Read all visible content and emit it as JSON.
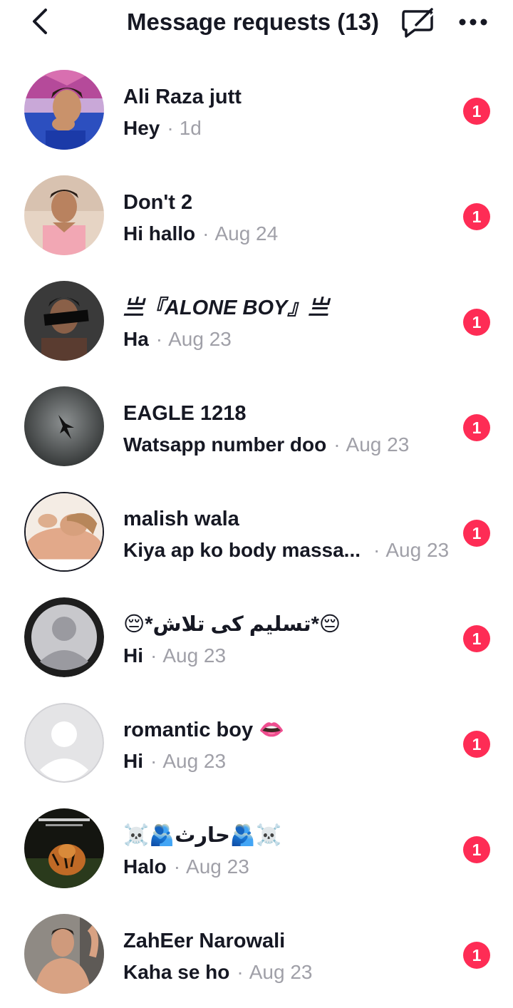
{
  "header": {
    "title": "Message requests (13)",
    "back_icon": "chevron-left-icon",
    "comment_icon": "comment-off-icon",
    "more_icon": "more-horizontal-icon"
  },
  "colors": {
    "badge": "#fe2c55",
    "text_primary": "#161823",
    "text_secondary": "#a0a0a8"
  },
  "requests": [
    {
      "name": "Ali Raza jutt",
      "message": "Hey",
      "time": "1d",
      "unread": "1"
    },
    {
      "name": "Don't 2",
      "message": "Hi hallo",
      "time": "Aug 24",
      "unread": "1"
    },
    {
      "name": "亗『ALONE BOY』亗",
      "message": "Ha",
      "time": "Aug 23",
      "unread": "1"
    },
    {
      "name": "EAGLE 1218",
      "message": "Watsapp number doo",
      "time": "Aug 23",
      "unread": "1"
    },
    {
      "name": "malish wala",
      "message": "Kiya ap ko body massa...",
      "time": "Aug 23",
      "unread": "1"
    },
    {
      "name": "😔*تسلیم کی تلاش*😔",
      "message": "Hi",
      "time": "Aug 23",
      "unread": "1"
    },
    {
      "name": "romantic boy 👄",
      "message": "Hi",
      "time": "Aug 23",
      "unread": "1"
    },
    {
      "name": "☠️🫂حارث🫂☠️",
      "message": "Halo",
      "time": "Aug 23",
      "unread": "1"
    },
    {
      "name": "ZahEer Narowali",
      "message": "Kaha se ho",
      "time": "Aug 23",
      "unread": "1"
    }
  ]
}
